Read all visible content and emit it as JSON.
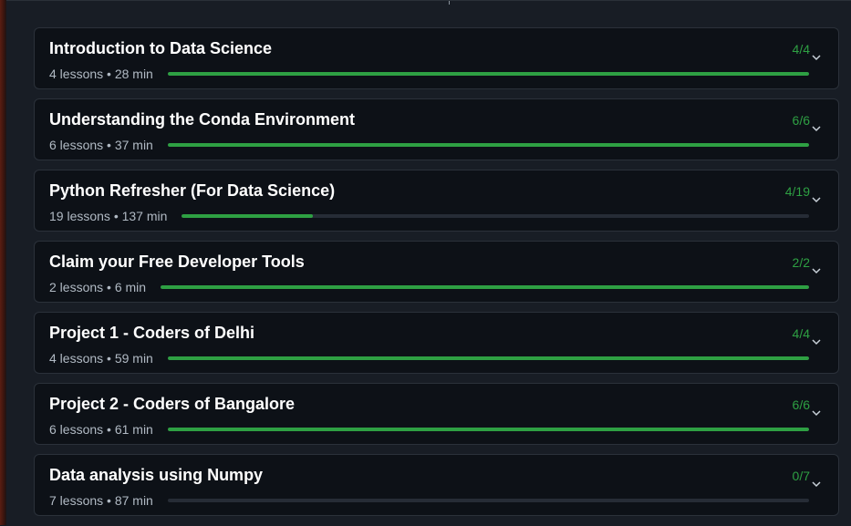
{
  "modules": [
    {
      "title": "Introduction to Data Science",
      "meta": "4 lessons • 28 min",
      "count": "4/4",
      "progress": 1.0
    },
    {
      "title": "Understanding the Conda Environment",
      "meta": "6 lessons • 37 min",
      "count": "6/6",
      "progress": 1.0
    },
    {
      "title": "Python Refresher (For Data Science)",
      "meta": "19 lessons • 137 min",
      "count": "4/19",
      "progress": 0.21
    },
    {
      "title": "Claim your Free Developer Tools",
      "meta": "2 lessons • 6 min",
      "count": "2/2",
      "progress": 1.0
    },
    {
      "title": "Project 1 - Coders of Delhi",
      "meta": "4 lessons • 59 min",
      "count": "4/4",
      "progress": 1.0
    },
    {
      "title": "Project 2 - Coders of Bangalore",
      "meta": "6 lessons • 61 min",
      "count": "6/6",
      "progress": 1.0
    },
    {
      "title": "Data analysis using Numpy",
      "meta": "7 lessons • 87 min",
      "count": "0/7",
      "progress": 0.0
    }
  ],
  "colors": {
    "accent": "#2ea043",
    "track": "#262c36",
    "card": "#0d1117"
  },
  "icons": {
    "expand": "chevron-down-icon"
  }
}
